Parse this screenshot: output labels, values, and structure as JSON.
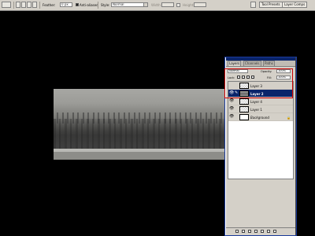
{
  "options_bar": {
    "feather_label": "Feather:",
    "feather_value": "0 px",
    "antialiased_label": "Anti-aliased",
    "style_label": "Style:",
    "style_value": "Normal",
    "width_label": "Width:",
    "height_label": "Height:",
    "well_tabs": [
      {
        "label": "Tool Presets"
      },
      {
        "label": "Layer Comps"
      }
    ]
  },
  "layers_panel": {
    "tabs": [
      {
        "label": "Layers"
      },
      {
        "label": "Channels"
      },
      {
        "label": "Paths"
      }
    ],
    "blend_mode": "Normal",
    "opacity_label": "Opacity:",
    "opacity_value": "100%",
    "lock_label": "Lock:",
    "fill_label": "Fill:",
    "fill_value": "100%",
    "layers": [
      {
        "name": "Layer 3",
        "selected": false,
        "visible": false,
        "thumb": "transparent"
      },
      {
        "name": "Layer 2",
        "selected": true,
        "visible": true,
        "thumb": "image"
      },
      {
        "name": "Layer 4",
        "selected": false,
        "visible": true,
        "thumb": "transparent"
      },
      {
        "name": "Layer 1",
        "selected": false,
        "visible": true,
        "thumb": "transparent"
      },
      {
        "name": "Background",
        "selected": false,
        "visible": true,
        "thumb": "white",
        "locked": true
      }
    ]
  },
  "colors": {
    "canvas_bg": "#000000",
    "ui_gray": "#d4d0c8",
    "selection_blue": "#0a246a",
    "annotation_red": "#cc0000"
  }
}
